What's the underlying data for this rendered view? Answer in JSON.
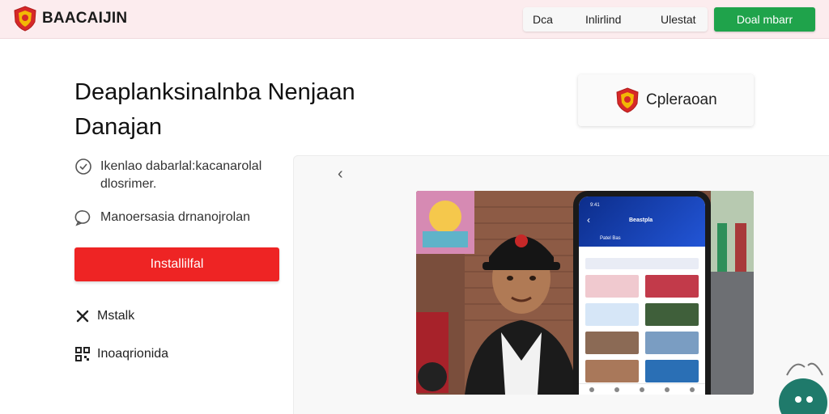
{
  "header": {
    "brand": "BAACAIJIN",
    "nav": [
      "Dca",
      "Inlirlind",
      "Ulestat"
    ],
    "cta_label": "Doal mbarr"
  },
  "hero": {
    "heading": "Deaplanksinalnba Nenjaan Danajan",
    "features": [
      {
        "icon": "check-circle-icon",
        "text": "Ikenlao dabarlal:kacanarolal dlosrimer."
      },
      {
        "icon": "chat-bubble-icon",
        "text": "Manoersasia drnanojrolan"
      }
    ],
    "install_label": "Installilfal",
    "links": [
      {
        "icon": "close-icon",
        "text": "Mstalk"
      },
      {
        "icon": "qr-code-icon",
        "text": "Inoaqrionida"
      }
    ]
  },
  "partner": {
    "label": "Cpleraoan"
  },
  "phone_screen": {
    "time": "9:41",
    "title": "Beastpla",
    "subtitle": "Patel Bas"
  },
  "colors": {
    "topbar_bg": "#fcecee",
    "cta_green": "#1fa34b",
    "install_red": "#ee2424",
    "chat_teal": "#1f7a6b",
    "app_blue": "#1646b8"
  }
}
